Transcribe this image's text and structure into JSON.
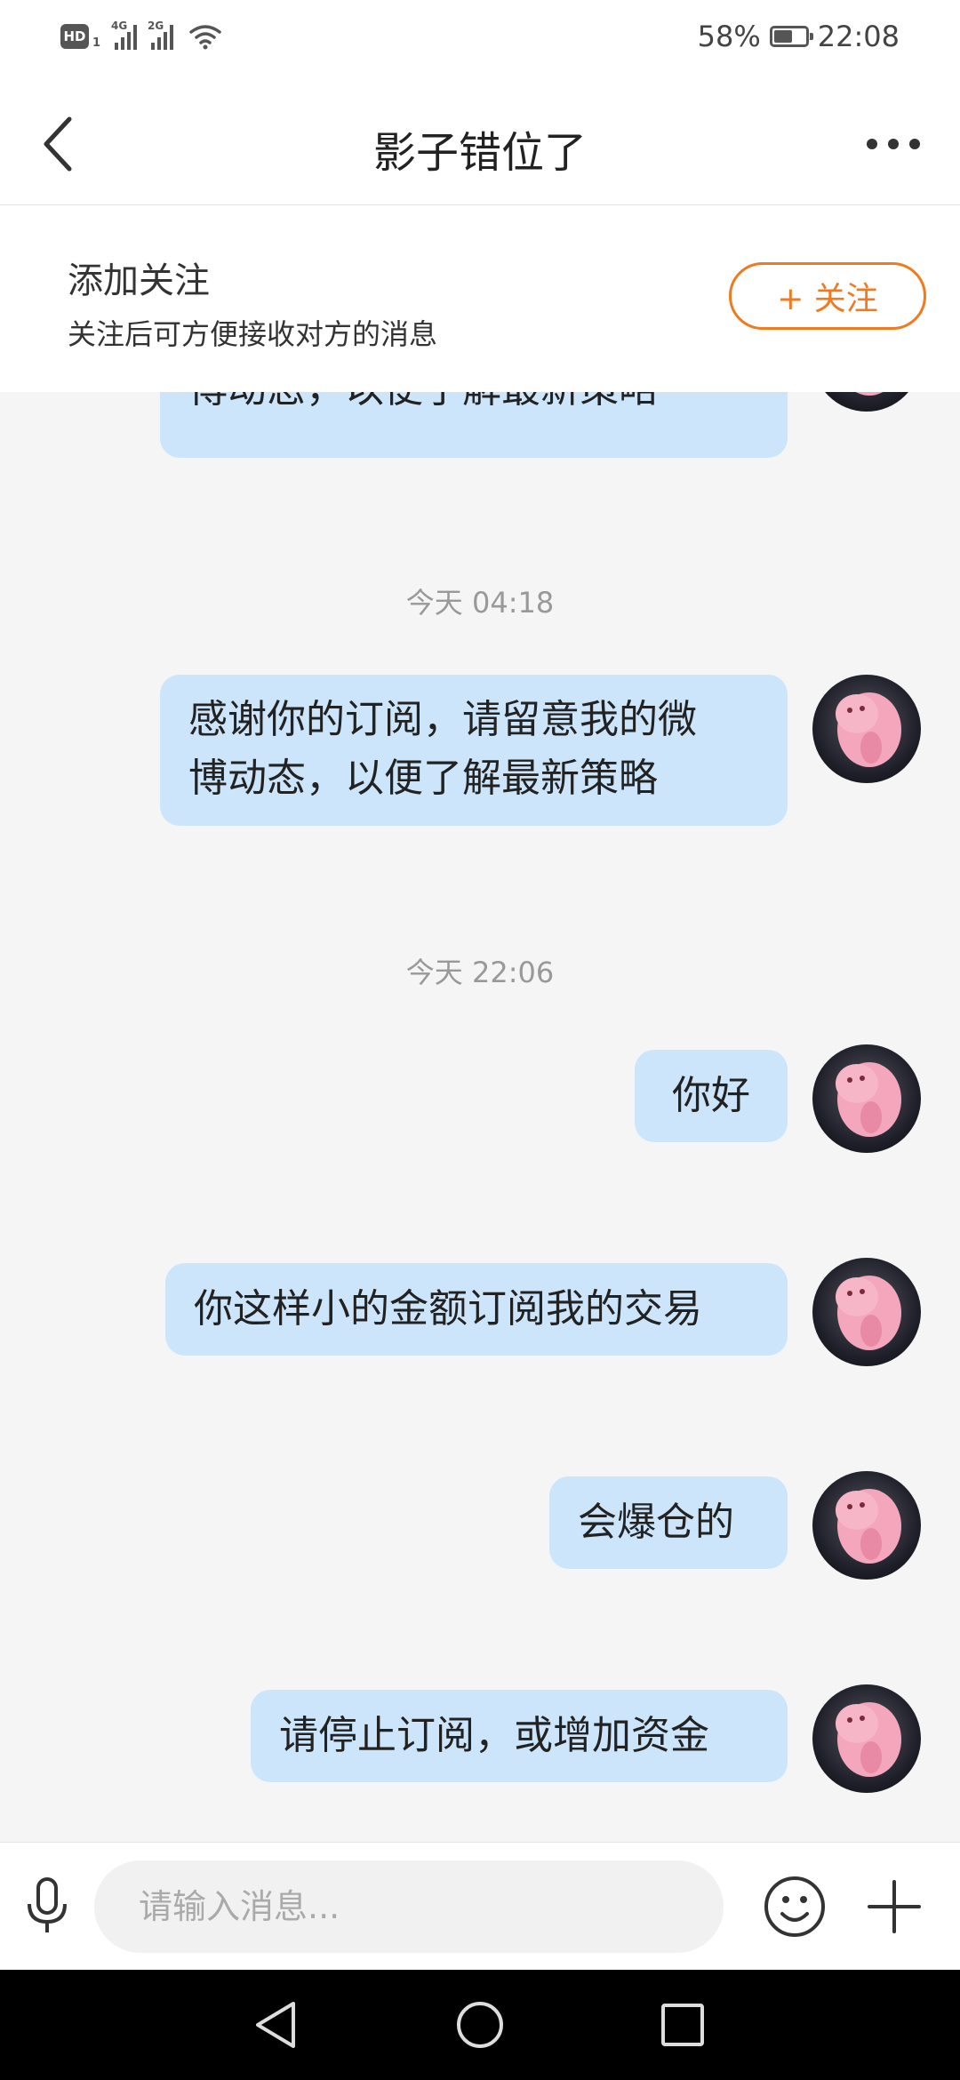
{
  "status_bar": {
    "hd_label": "HD",
    "sim_number": "1",
    "network_1": "4G",
    "network_2": "2G",
    "battery_percent": "58%",
    "battery_level": 0.58,
    "time": "22:08"
  },
  "header": {
    "title": "影子错位了"
  },
  "follow_bar": {
    "title": "添加关注",
    "description": "关注后可方便接收对方的消息",
    "button_label": "+ 关注"
  },
  "chat": {
    "partial_message_tail": "博动态，以便了解最新策略",
    "timestamp_1": "今天 04:18",
    "message_1_line1": "感谢你的订阅，请留意我的微",
    "message_1_line2": "博动态，以便了解最新策略",
    "timestamp_2": "今天 22:06",
    "message_2": "你好",
    "message_3": "你这样小的金额订阅我的交易",
    "message_4": "会爆仓的",
    "message_5": "请停止订阅，或增加资金"
  },
  "input_bar": {
    "placeholder": "请输入消息..."
  },
  "colors": {
    "accent": "#f07a20",
    "bubble": "#cde5fb",
    "chat_background": "#f5f5f5"
  },
  "icons": [
    "back-arrow-icon",
    "more-dots-icon",
    "mic-icon",
    "emoji-icon",
    "plus-icon",
    "nav-back-icon",
    "nav-home-icon",
    "nav-recents-icon",
    "pig-avatar"
  ]
}
